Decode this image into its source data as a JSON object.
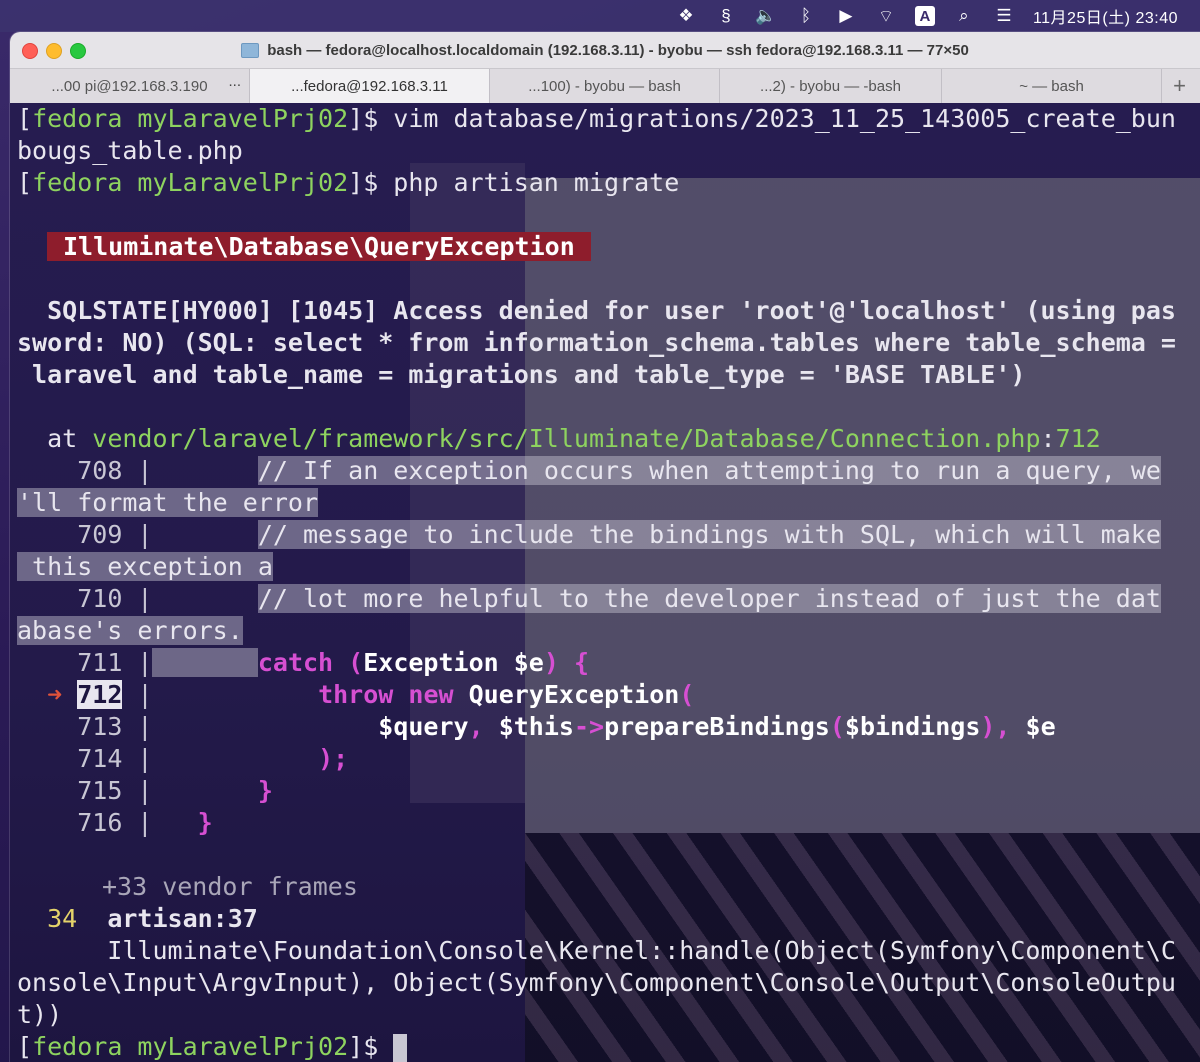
{
  "menubar": {
    "icons": [
      "dropbox-icon",
      "pin-icon",
      "volume-icon",
      "bluetooth-icon",
      "play-icon",
      "wifi-icon",
      "input-source-icon",
      "search-icon",
      "control-center-icon"
    ],
    "input_source": "A",
    "clock": "11月25日(土) 23:40"
  },
  "window": {
    "title": "bash — fedora@localhost.localdomain (192.168.3.11) - byobu — ssh fedora@192.168.3.11 — 77×50",
    "tabs": [
      {
        "label": "...00 pi@192.168.3.190",
        "more": "..."
      },
      {
        "label": "...fedora@192.168.3.11"
      },
      {
        "label": "...100) - byobu — bash"
      },
      {
        "label": "...2) - byobu — -bash"
      },
      {
        "label": "~ — bash"
      }
    ],
    "add_tab": "+"
  },
  "terminal": {
    "prompt_open": "[",
    "prompt_user": "fedora myLaravelPrj02",
    "prompt_close": "]$ ",
    "cmd1_a": "vim database/migrations/2023_11_25_143005_create_bun",
    "cmd1_b": "bougs_table.php",
    "cmd2": "php artisan migrate",
    "exception_class": "Illuminate\\Database\\QueryException",
    "error_1": "  SQLSTATE[HY000] [1045] Access denied for user 'root'@'localhost' (using pas",
    "error_2": "sword: NO) (SQL: select * from information_schema.tables where table_schema =",
    "error_3": " laravel and table_name = migrations and table_type = 'BASE TABLE')",
    "at_label": "  at ",
    "at_path": "vendor/laravel/framework/src/Illuminate/Database/Connection.php",
    "at_colon": ":",
    "at_line": "712",
    "code": {
      "l708": "708",
      "l708_text_a": "// If an exception occurs when attempting to run a query, we",
      "l708_text_b": "'ll format the error",
      "l709": "709",
      "l709_text_a": "// message to include the bindings with SQL, which will make",
      "l709_text_b": " this exception a",
      "l710": "710",
      "l710_text_a": "// lot more helpful to the developer instead of just the dat",
      "l710_text_b": "abase's errors.",
      "l711": "711",
      "l711_catch": "catch",
      "l711_open": " (",
      "l711_cls": "Exception $e",
      "l711_close": ") {",
      "l712": "712",
      "l712_throw": "throw",
      "l712_new": " new ",
      "l712_cls": "QueryException",
      "l712_paren": "(",
      "l713": "713",
      "l713_query": "$query",
      "l713_comma": ", ",
      "l713_this": "$this",
      "l713_arrow": "->",
      "l713_fn": "prepareBindings",
      "l713_p1": "(",
      "l713_bind": "$bindings",
      "l713_p2": "), ",
      "l713_e": "$e",
      "l714": "714",
      "l714_text": ");",
      "l715": "715",
      "l715_text": "}",
      "l716": "716",
      "l716_text": "}",
      "pipe": " |",
      "marker": "➜"
    },
    "vendor_frames": "+33 vendor frames",
    "frame_num": "34",
    "frame_file": "artisan:37",
    "frame_1": "      Illuminate\\Foundation\\Console\\Kernel::handle(Object(Symfony\\Component\\C",
    "frame_2": "onsole\\Input\\ArgvInput), Object(Symfony\\Component\\Console\\Output\\ConsoleOutpu",
    "frame_3": "t))"
  }
}
